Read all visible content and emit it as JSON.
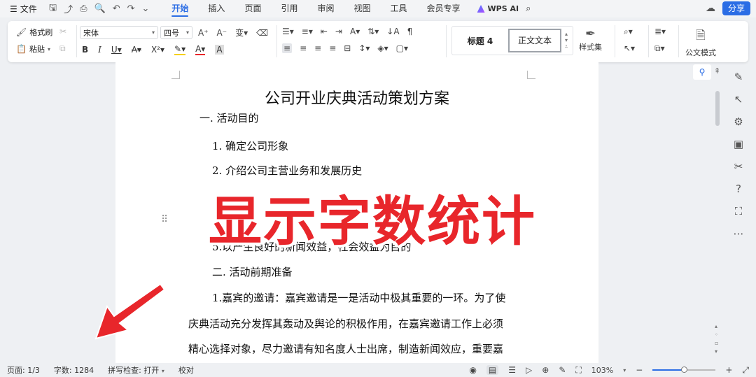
{
  "menubar": {
    "file_label": "文件",
    "tabs": [
      "开始",
      "插入",
      "页面",
      "引用",
      "审阅",
      "视图",
      "工具",
      "会员专享"
    ],
    "active_tab": "开始",
    "ai_label": "WPS AI",
    "share_label": "分享"
  },
  "ribbon": {
    "format_painter": "格式刷",
    "paste": "粘贴",
    "font_name": "宋体",
    "font_size": "四号",
    "style_heading": "标题 4",
    "style_body": "正文文本",
    "style_set": "样式集",
    "official_mode": "公文模式"
  },
  "document": {
    "title": "公司开业庆典活动策划方案",
    "lines": [
      "一. 活动目的",
      "1. 确定公司形象",
      "2. 介绍公司主营业务和发展历史",
      "5.以产生良好的新闻效益，社会效益为目的",
      "二. 活动前期准备",
      "1.嘉宾的邀请：嘉宾邀请是一是活动中极其重要的一环。为了使",
      "庆典活动充分发挥其轰动及舆论的积极作用，在嘉宾邀请工作上必须",
      "精心选择对象，尽力邀请有知名度人士出席，制造新闻效应，重要嘉"
    ]
  },
  "overlay_text": "显示字数统计",
  "statusbar": {
    "page": "页面: 1/3",
    "word_count": "字数: 1284",
    "spell_check": "拼写检查: 打开",
    "proofread": "校对",
    "zoom": "103%",
    "zoom_level": 0.5
  },
  "colors": {
    "accent": "#2b6de5",
    "overlay": "#e8262b"
  }
}
